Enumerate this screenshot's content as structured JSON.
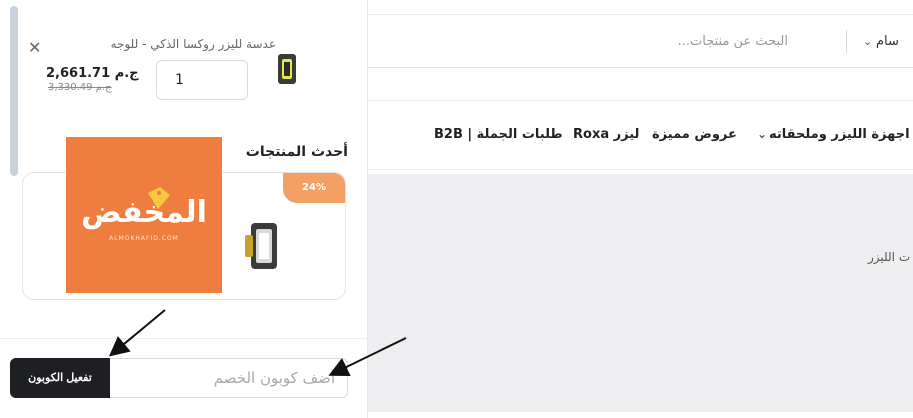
{
  "header": {
    "search_placeholder": "البحث عن منتجات...",
    "category_label": "سام"
  },
  "nav": {
    "items": [
      {
        "label": "اجهزة الليزر وملحقاته"
      },
      {
        "label": "عروض مميزة"
      },
      {
        "label": "ليزر Roxa"
      },
      {
        "label": "طلبات الجملة | B2B"
      }
    ]
  },
  "hero": {
    "text": "ت الليزر"
  },
  "cart": {
    "item": {
      "title": "عدسة لليزر روكسا الذكي - للوجه",
      "quantity": "1",
      "price": "2,661.71 ج.م",
      "old_price": "3,330.49 ج.م"
    },
    "latest_products_title": "أحدث المنتجات",
    "product_card": {
      "discount": "24%"
    },
    "watermark": {
      "word": "المخفض",
      "sub": "ALMOKHAFID.COM"
    },
    "coupon": {
      "placeholder": "أضف كوبون الخصم",
      "value": "",
      "button_label": "تفعيل الكوبون"
    }
  },
  "colors": {
    "accent_orange": "#ef7d3f",
    "badge_orange": "#f4a065",
    "button_dark": "#1e1f22",
    "scrollbar": "#c8d2dd"
  }
}
